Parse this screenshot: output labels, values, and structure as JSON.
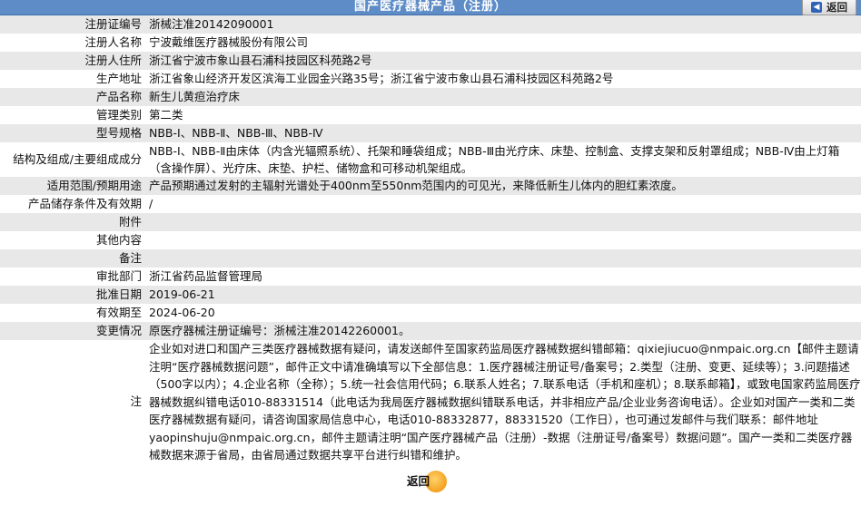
{
  "header": {
    "title": "国产医疗器械产品（注册）",
    "back_label": "返回"
  },
  "rows": [
    {
      "label": "注册证编号",
      "value": "浙械注准20142090001"
    },
    {
      "label": "注册人名称",
      "value": "宁波戴维医疗器械股份有限公司"
    },
    {
      "label": "注册人住所",
      "value": "浙江省宁波市象山县石浦科技园区科苑路2号"
    },
    {
      "label": "生产地址",
      "value": "浙江省象山经济开发区滨海工业园金兴路35号；浙江省宁波市象山县石浦科技园区科苑路2号"
    },
    {
      "label": "产品名称",
      "value": "新生儿黄疸治疗床"
    },
    {
      "label": "管理类别",
      "value": "第二类"
    },
    {
      "label": "型号规格",
      "value": "NBB-Ⅰ、NBB-Ⅱ、NBB-Ⅲ、NBB-Ⅳ"
    },
    {
      "label": "结构及组成/主要组成成分",
      "value": "NBB-Ⅰ、NBB-Ⅱ由床体（内含光辐照系统）、托架和睡袋组成；NBB-Ⅲ由光疗床、床垫、控制盒、支撑支架和反射罩组成；NBB-Ⅳ由上灯箱（含操作屏）、光疗床、床垫、护栏、储物盒和可移动机架组成。"
    },
    {
      "label": "适用范围/预期用途",
      "value": "产品预期通过发射的主辐射光谱处于400nm至550nm范围内的可见光，来降低新生儿体内的胆红素浓度。"
    },
    {
      "label": "产品储存条件及有效期",
      "value": "/"
    },
    {
      "label": "附件",
      "value": ""
    },
    {
      "label": "其他内容",
      "value": ""
    },
    {
      "label": "备注",
      "value": ""
    },
    {
      "label": "审批部门",
      "value": "浙江省药品监督管理局"
    },
    {
      "label": "批准日期",
      "value": "2019-06-21"
    },
    {
      "label": "有效期至",
      "value": "2024-06-20"
    },
    {
      "label": "变更情况",
      "value": "原医疗器械注册证编号：浙械注准20142260001。"
    },
    {
      "label": "注",
      "value": "企业如对进口和国产三类医疗器械数据有疑问，请发送邮件至国家药监局医疗器械数据纠错邮箱：qixiejiucuo@nmpaic.org.cn【邮件主题请注明“医疗器械数据问题”，邮件正文中请准确填写以下全部信息：1.医疗器械注册证号/备案号；2.类型（注册、变更、延续等）；3.问题描述（500字以内）；4.企业名称（全称）；5.统一社会信用代码；6.联系人姓名；7.联系电话（手机和座机）；8.联系邮箱】，或致电国家药监局医疗器械数据纠错电话010-88331514（此电话为我局医疗器械数据纠错联系电话，并非相应产品/企业业务咨询电话）。企业如对国产一类和二类医疗器械数据有疑问，请咨询国家局信息中心，电话010-88332877，88331520（工作日），也可通过发邮件与我们联系：邮件地址yaopinshuju@nmpaic.org.cn，邮件主题请注明“国产医疗器械产品（注册）-数据（注册证号/备案号）数据问题”。国产一类和二类医疗器械数据来源于省局，由省局通过数据共享平台进行纠错和维护。"
    }
  ],
  "footer": {
    "back_label": "返回"
  }
}
